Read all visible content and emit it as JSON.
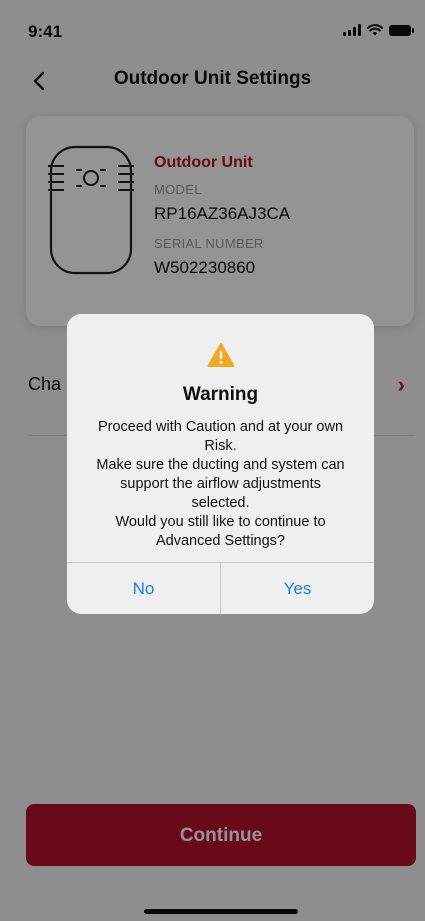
{
  "status_bar": {
    "time": "9:41"
  },
  "header": {
    "title": "Outdoor Unit Settings"
  },
  "device": {
    "name": "Outdoor Unit",
    "model_label": "MODEL",
    "model_value": "RP16AZ36AJ3CA",
    "serial_label": "SERIAL NUMBER",
    "serial_value": "W502230860"
  },
  "list": {
    "row_label_partial": "Cha"
  },
  "footer": {
    "continue_label": "Continue"
  },
  "alert": {
    "title": "Warning",
    "message_lines": [
      "Proceed with Caution and at your own",
      "Risk.",
      "Make sure the ducting and system can",
      "support the airflow adjustments",
      "selected.",
      "Would you still like to continue to",
      "Advanced Settings?"
    ],
    "no_label": "No",
    "yes_label": "Yes"
  },
  "colors": {
    "brand": "#b5122e",
    "link": "#1a7ee6",
    "warning": "#f5a623"
  }
}
